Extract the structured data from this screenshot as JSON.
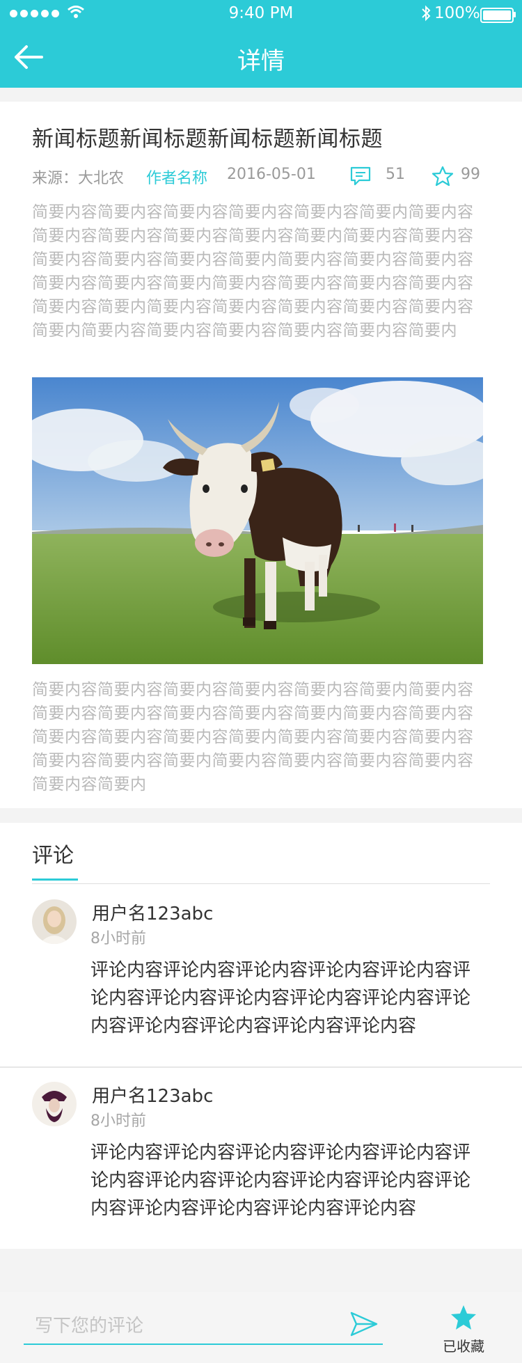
{
  "status_bar": {
    "time": "9:40 PM",
    "battery": "100%"
  },
  "nav": {
    "title": "详情"
  },
  "article": {
    "title": "新闻标题新闻标题新闻标题新闻标题",
    "source": "来源：大北农",
    "author": "作者名称",
    "date": "2016-05-01",
    "comment_count": "51",
    "favorite_count": "99",
    "summary_top": "简要内容简要内容简要内容简要内容简要内容简要内简要内容简要内容简要内容简要内容简要内容简要内简要内容简要内容简要内容简要内容简要内容简要内简要内容简要内容简要内容简要内容简要内容简要内简要内容简要内容简要内容简要内容简要内容简要内简要内容简要内容简要内容简要内容简要内容简要内简要内容简要内容简要内容简要内容简要内容简要内",
    "summary_bottom": "简要内容简要内容简要内容简要内容简要内容简要内简要内容简要内容简要内容简要内容简要内容简要内简要内容简要内容简要内容简要内容简要内容简要内简要内容简要内容简要内容简要内容简要内容简要内简要内容简要内容简要内容简要内容简要内容简要内"
  },
  "comments": {
    "heading": "评论",
    "items": [
      {
        "username": "用户名123abc",
        "time": "8小时前",
        "text": "评论内容评论内容评论内容评论内容评论内容评论内容评论内容评论内容评论内容评论内容评论内容评论内容评论内容评论内容评论内容"
      },
      {
        "username": "用户名123abc",
        "time": "8小时前",
        "text": "评论内容评论内容评论内容评论内容评论内容评论内容评论内容评论内容评论内容评论内容评论内容评论内容评论内容评论内容评论内容"
      }
    ]
  },
  "bottom_bar": {
    "input_placeholder": "写下您的评论",
    "favorite_label": "已收藏"
  },
  "colors": {
    "accent": "#2ccbd7",
    "muted_text": "#b9b9b9",
    "body_text": "#333333"
  },
  "icons": {
    "back": "back-arrow-icon",
    "comment": "comment-bubble-icon",
    "favorite": "star-icon",
    "send": "send-icon",
    "favorited": "star-filled-icon"
  }
}
